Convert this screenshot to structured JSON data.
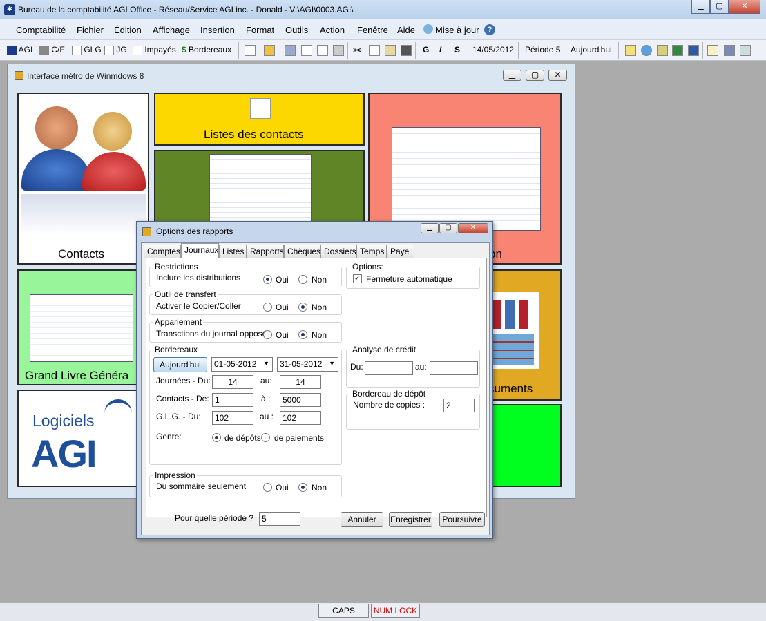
{
  "app": {
    "title": "Bureau de la comptabilité AGI Office - Réseau/Service AGI inc. - Donald - V:\\AGI\\0003.AGI\\"
  },
  "menu": [
    "Comptabilité",
    "Fichier",
    "Édition",
    "Affichage",
    "Insertion",
    "Format",
    "Outils",
    "Action",
    "Fenêtre",
    "Aide",
    "Mise à jour"
  ],
  "toolbar": {
    "agi": "AGI",
    "cf": "C/F",
    "glg": "GLG",
    "jg": "JG",
    "impayes": "Impayés",
    "bordereaux": "Bordereaux",
    "bold": "G",
    "italic": "I",
    "underline": "S",
    "date": "14/05/2012",
    "periode": "Période 5",
    "today": "Aujourd'hui"
  },
  "metro": {
    "title": "Interface métro de Winmdows 8",
    "tiles": {
      "contacts": "Contacts",
      "listes": "Listes des contacts",
      "tile_right_label": "on",
      "gl": "Grand Livre Généra",
      "docs": "cuments"
    },
    "logo_line1": "Logiciels",
    "logo_line2": "AGI"
  },
  "dialog": {
    "title": "Options des rapports",
    "tabs": [
      "Comptes",
      "Journaux",
      "Listes",
      "Rapports",
      "Chèques",
      "Dossiers",
      "Temps",
      "Paye"
    ],
    "restrictions": {
      "legend": "Restrictions",
      "label": "Inclure les distributions",
      "yes": "Oui",
      "no": "Non"
    },
    "options": {
      "legend": "Options:",
      "fermeture": "Fermeture automatique"
    },
    "transfert": {
      "legend": "Outil de transfert",
      "label": "Activer le Copier/Coller",
      "yes": "Oui",
      "no": "Non"
    },
    "appariement": {
      "legend": "Appariement",
      "label": "Transctions du journal opposé",
      "yes": "Oui",
      "no": "Non"
    },
    "bordereaux": {
      "legend": "Bordereaux",
      "today_btn": "Aujourd'hui",
      "date_from": "01-05-2012",
      "date_to": "31-05-2012",
      "journees_label": "Journées - Du:",
      "journees_from": "14",
      "au1": "au:",
      "journees_to": "14",
      "contacts_label": "Contacts - De:",
      "contacts_from": "1",
      "a": "à :",
      "contacts_to": "5000",
      "glg_label": "G.L.G. - Du:",
      "glg_from": "102",
      "au2": "au :",
      "glg_to": "102",
      "genre_label": "Genre:",
      "genre_depots": "de dépôts",
      "genre_paiements": "de paiements"
    },
    "credit": {
      "legend": "Analyse de crédit",
      "du": "Du:",
      "au": "au:",
      "du_value": "",
      "au_value": ""
    },
    "depot": {
      "legend": "Bordereau de dépôt",
      "label": "Nombre de copies :",
      "value": "2"
    },
    "impression": {
      "legend": "Impression",
      "label": "Du sommaire seulement",
      "yes": "Oui",
      "no": "Non"
    },
    "periode_label": "Pour quelle période ?",
    "periode_value": "5",
    "buttons": {
      "cancel": "Annuler",
      "save": "Enregistrer",
      "continue": "Poursuivre"
    }
  },
  "status": {
    "caps": "CAPS",
    "numlock": "NUM LOCK"
  },
  "colors": {
    "tile_yellow": "#fcd700",
    "tile_olive": "#5f8526",
    "tile_salmon": "#f98473",
    "tile_green_light": "#99f59a",
    "tile_gold": "#e0a823",
    "tile_green": "#00ff1f",
    "numlock_red": "#d00000"
  }
}
